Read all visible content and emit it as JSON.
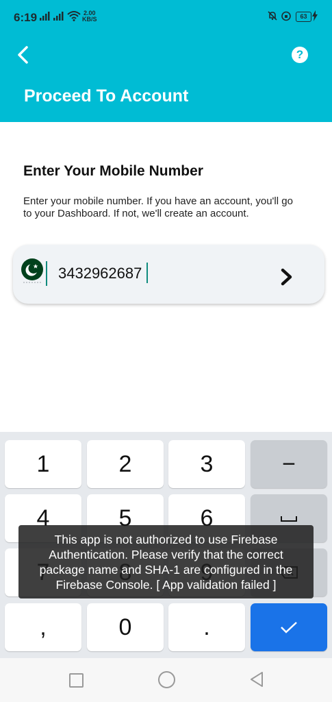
{
  "status_bar": {
    "time": "6:19",
    "net_speed_value": "2.00",
    "net_speed_unit": "KB/S",
    "battery": "63"
  },
  "header": {
    "title": "Proceed To Account",
    "help_label": "?"
  },
  "content": {
    "heading": "Enter Your Mobile Number",
    "description": "Enter your mobile number. If you have an account, you'll go to your Dashboard. If not, we'll create an account.",
    "phone_value": "3432962687"
  },
  "keyboard": {
    "k1": "1",
    "k2": "2",
    "k3": "3",
    "k_minus": "−",
    "k4": "4",
    "k5": "5",
    "k6": "6",
    "k7": "7",
    "k8": "8",
    "k9": "9",
    "k_comma": ",",
    "k0": "0",
    "k_dot": "."
  },
  "toast": {
    "message": "This app is not authorized to use Firebase Authentication. Please verify that the correct package name and SHA-1 are configured in the Firebase Console. [ App validation failed ]"
  },
  "colors": {
    "header_bg": "#00bcd4",
    "accent": "#0f8b7d",
    "done_key": "#1a73e8"
  },
  "icons": {
    "back": "chevron-left-icon",
    "help": "help-icon",
    "flag": "pakistan-flag-icon",
    "next": "chevron-right-icon",
    "space": "space-icon",
    "done": "checkmark-icon"
  }
}
